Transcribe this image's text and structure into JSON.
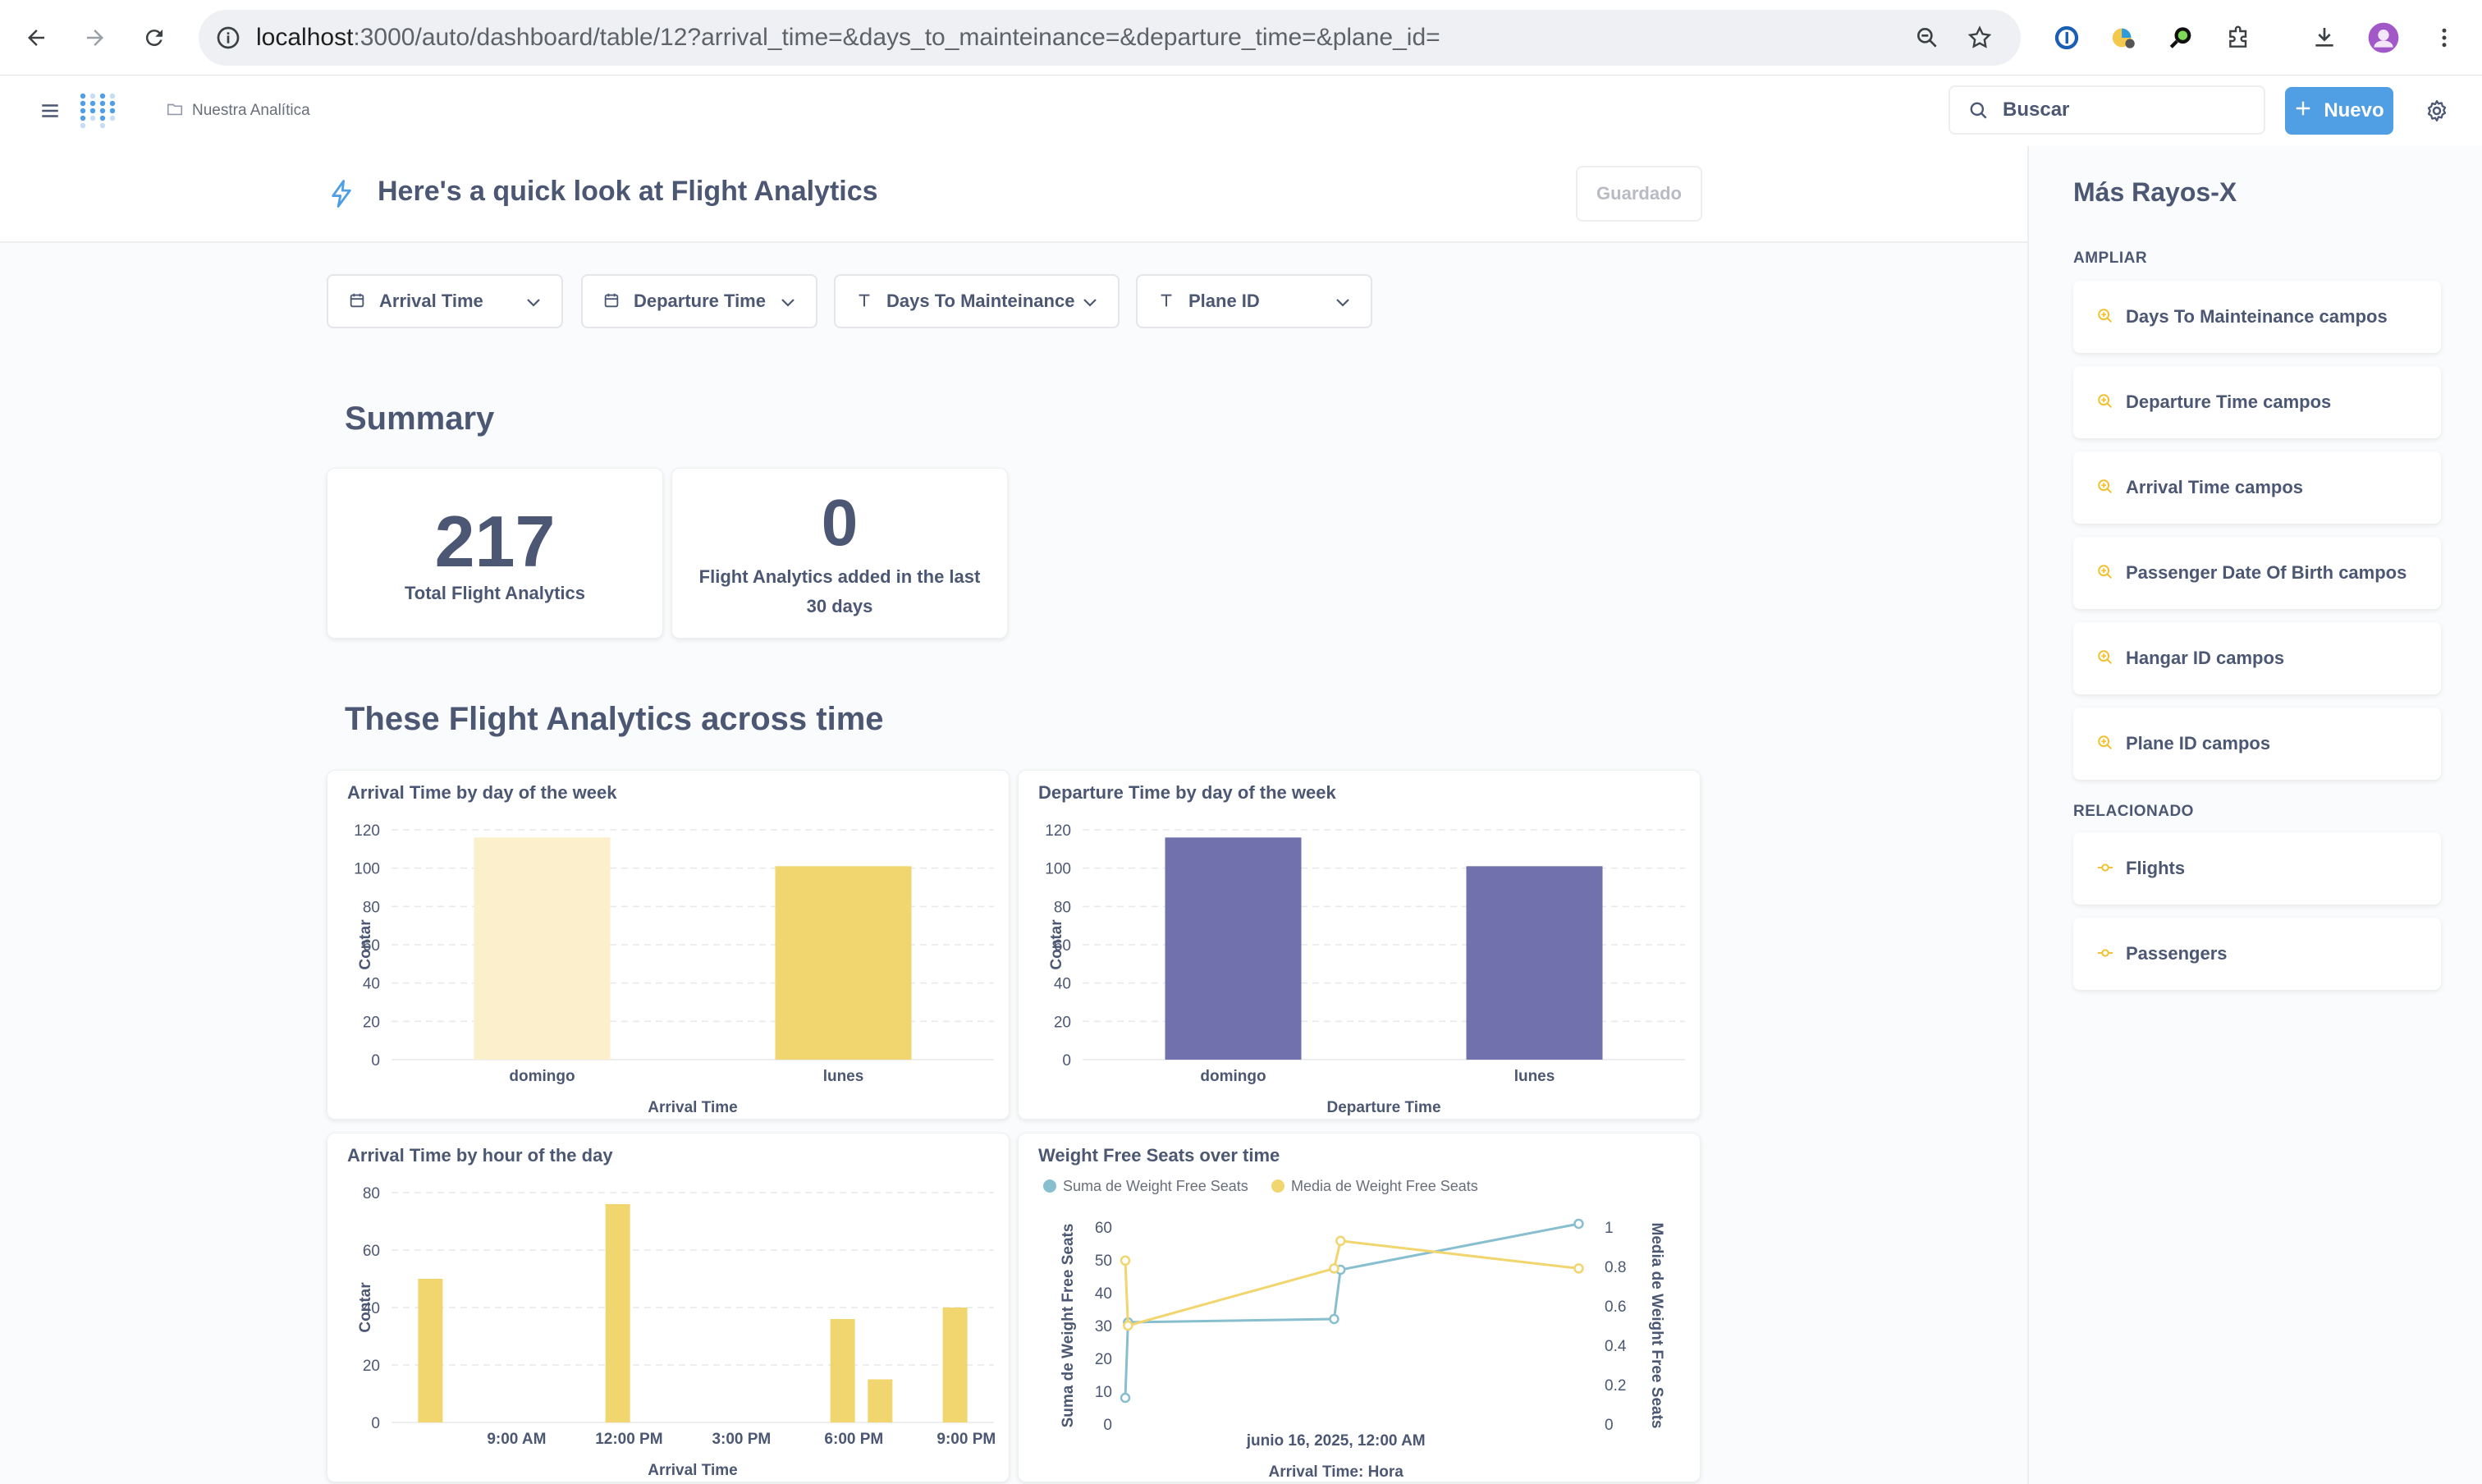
{
  "browser": {
    "url_host": "localhost",
    "url_rest": ":3000/auto/dashboard/table/12?arrival_time=&days_to_mainteinance=&departure_time=&plane_id="
  },
  "header": {
    "breadcrumb": "Nuestra Analítica",
    "search_placeholder": "Buscar",
    "new_button": "Nuevo"
  },
  "page": {
    "title": "Here's a quick look at Flight Analytics",
    "saved_button": "Guardado"
  },
  "filters": [
    {
      "label": "Arrival Time",
      "icon": "calendar-icon"
    },
    {
      "label": "Departure Time",
      "icon": "calendar-icon"
    },
    {
      "label": "Days To Mainteinance",
      "icon": "text-icon"
    },
    {
      "label": "Plane ID",
      "icon": "text-icon"
    }
  ],
  "summary": {
    "title": "Summary",
    "cards": [
      {
        "value": "217",
        "label": "Total Flight Analytics"
      },
      {
        "value": "0",
        "label": "Flight Analytics added in the last 30 days"
      }
    ]
  },
  "across_time": {
    "title": "These Flight Analytics across time"
  },
  "chart_data": [
    {
      "type": "bar",
      "title": "Arrival Time by day of the week",
      "categories": [
        "domingo",
        "lunes"
      ],
      "values": [
        116,
        101
      ],
      "xlabel": "Arrival Time",
      "ylabel": "Contar",
      "ylim": [
        0,
        120
      ],
      "yticks": [
        0,
        20,
        40,
        60,
        80,
        100,
        120
      ],
      "colors": [
        "#fbf0cb",
        "#f1d56e"
      ],
      "grid": true
    },
    {
      "type": "bar",
      "title": "Departure Time by day of the week",
      "categories": [
        "domingo",
        "lunes"
      ],
      "values": [
        116,
        101
      ],
      "xlabel": "Departure Time",
      "ylabel": "Contar",
      "ylim": [
        0,
        120
      ],
      "yticks": [
        0,
        20,
        40,
        60,
        80,
        100,
        120
      ],
      "colors": [
        "#7172ad",
        "#7172ad"
      ],
      "grid": true
    },
    {
      "type": "bar",
      "title": "Arrival Time by hour of the day",
      "x": [
        6,
        11,
        17,
        18,
        20
      ],
      "values": [
        50,
        76,
        36,
        15,
        40
      ],
      "xticks": [
        "9:00 AM",
        "12:00 PM",
        "3:00 PM",
        "6:00 PM",
        "9:00 PM"
      ],
      "xlabel": "Arrival Time",
      "ylabel": "Contar",
      "ylim": [
        0,
        80
      ],
      "yticks": [
        0,
        20,
        40,
        60,
        80
      ],
      "color": "#f1d56e",
      "grid": true
    },
    {
      "type": "line",
      "title": "Weight Free Seats over time",
      "x_ticks": [
        "junio 16, 2025, 12:00 AM"
      ],
      "xlabel": "Arrival Time: Hora",
      "ylabel_left": "Suma de Weight Free Seats",
      "ylabel_right": "Media de Weight Free Seats",
      "ylim_left": [
        0,
        60
      ],
      "ylim_right": [
        0,
        1
      ],
      "yticks_left": [
        0,
        10,
        20,
        30,
        40,
        50,
        60
      ],
      "yticks_right": [
        "0",
        "0.2",
        "0.4",
        "0.6",
        "0.8",
        "1"
      ],
      "series": [
        {
          "name": "Suma de Weight Free Seats",
          "color": "#88bfcf",
          "axis": "left",
          "x": [
            0.0,
            0.03,
            2.28,
            2.35,
            4.95
          ],
          "values": [
            8,
            31,
            32,
            47,
            61
          ]
        },
        {
          "name": "Media de Weight Free Seats",
          "color": "#f1d56e",
          "axis": "right",
          "x": [
            0.0,
            0.03,
            2.28,
            2.35,
            4.95
          ],
          "values": [
            0.83,
            0.5,
            0.79,
            0.93,
            0.79
          ]
        }
      ]
    }
  ],
  "sidebar": {
    "title": "Más Rayos-X",
    "expand_heading": "AMPLIAR",
    "expand_items": [
      "Days To Mainteinance campos",
      "Departure Time campos",
      "Arrival Time campos",
      "Passenger Date Of Birth campos",
      "Hangar ID campos",
      "Plane ID campos"
    ],
    "related_heading": "RELACIONADO",
    "related_items": [
      "Flights",
      "Passengers"
    ]
  },
  "colors": {
    "brand": "#509ee3",
    "text": "#4c5773",
    "yellow": "#f1d56e",
    "purple": "#7172ad",
    "teal": "#88bfcf"
  }
}
